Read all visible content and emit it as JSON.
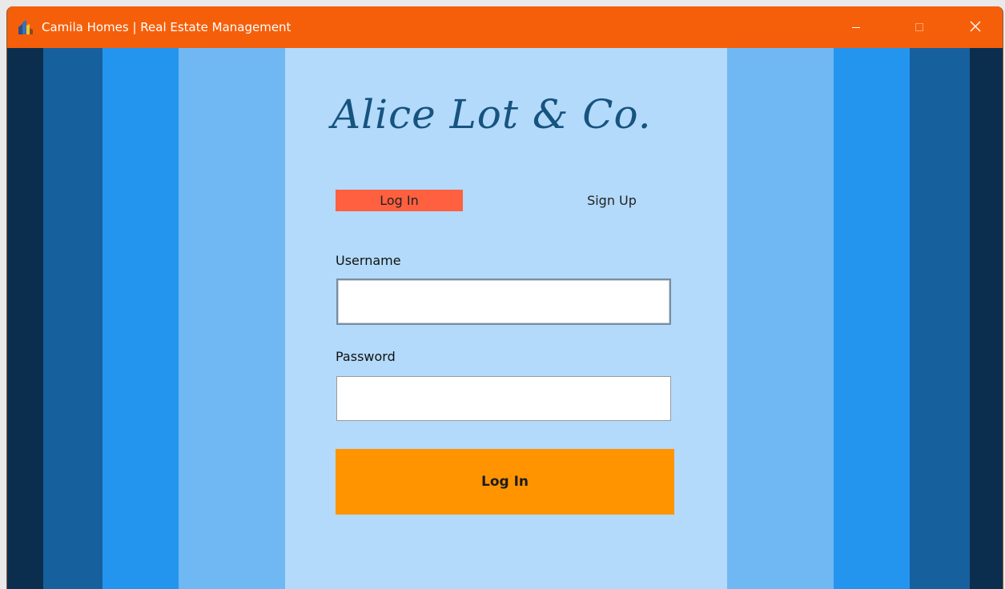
{
  "window": {
    "title": "Camila Homes | Real Estate Management"
  },
  "branding": {
    "logo_text": "Alice Lot & Co."
  },
  "tabs": [
    {
      "label": "Log In",
      "active": true
    },
    {
      "label": "Sign Up",
      "active": false
    }
  ],
  "form": {
    "username_label": "Username",
    "username_value": "",
    "password_label": "Password",
    "password_value": "",
    "submit_label": "Log In"
  },
  "icons": {
    "app": "buildings-icon",
    "minimize": "minimize-icon",
    "maximize": "maximize-icon",
    "close": "close-icon"
  },
  "colors": {
    "titlebar": "#f55f0a",
    "active_tab": "#ff6040",
    "submit_button": "#ff9400",
    "logo_text": "#17537f",
    "stripes": [
      "#0b2e4f",
      "#17609e",
      "#2495ef",
      "#6fb8f4",
      "#b3dafa"
    ]
  }
}
